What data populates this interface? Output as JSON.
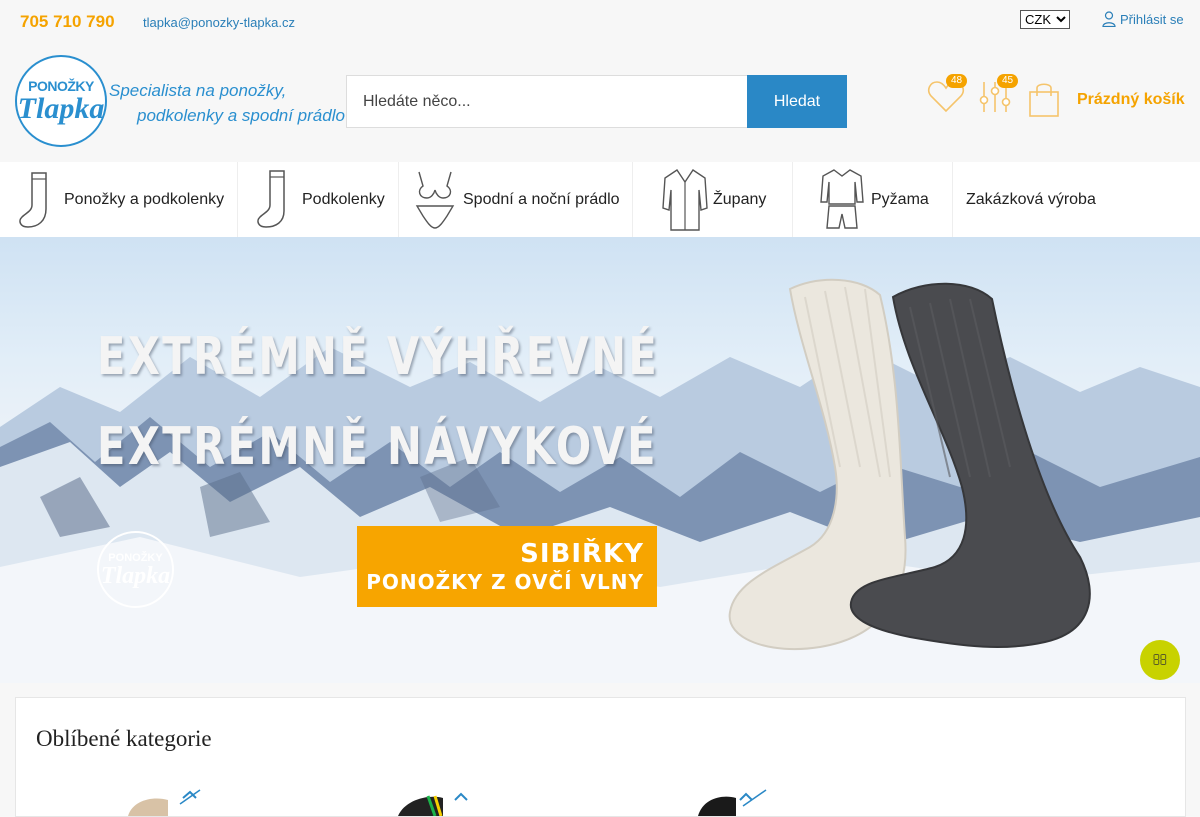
{
  "topbar": {
    "phone": "705 710 790",
    "email": "tlapka@ponozky-tlapka.cz",
    "currency": {
      "selected": "CZK",
      "options": [
        "CZK"
      ]
    },
    "login_label": "Přihlásit se"
  },
  "header": {
    "logo": {
      "top": "PONOŽKY",
      "main": "Tlapka"
    },
    "slogan": {
      "line1": "Specialista na ponožky,",
      "line2": "podkolenky a spodní prádlo"
    },
    "search": {
      "placeholder": "Hledáte něco...",
      "button_label": "Hledat"
    },
    "wishlist_count": "48",
    "compare_count": "45",
    "cart_label": "Prázdný košík"
  },
  "nav": {
    "items": [
      {
        "label": "Ponožky a podkolenky",
        "icon": "sock-icon"
      },
      {
        "label": "Podkolenky",
        "icon": "knee-sock-icon"
      },
      {
        "label": "Spodní a noční prádlo",
        "icon": "lingerie-icon"
      },
      {
        "label": "Župany",
        "icon": "bathrobe-icon"
      },
      {
        "label": "Pyžama",
        "icon": "pajamas-icon"
      },
      {
        "label": "Zakázková výroba",
        "icon": ""
      }
    ]
  },
  "banner": {
    "headline1": "EXTRÉMNĚ VÝHŘEVNÉ",
    "headline2": "EXTRÉMNĚ NÁVYKOVÉ",
    "cta_title": "SIBIŘKY",
    "cta_subtitle": "PONOŽKY Z OVČÍ VLNY",
    "logo_top": "PONOŽKY",
    "logo_main": "Tlapka"
  },
  "favorites": {
    "title": "Oblíbené kategorie"
  },
  "colors": {
    "accent_orange": "#f5a300",
    "link_blue": "#2a7fb8",
    "button_blue": "#2a88c6",
    "scroll_button": "#c8d200"
  }
}
